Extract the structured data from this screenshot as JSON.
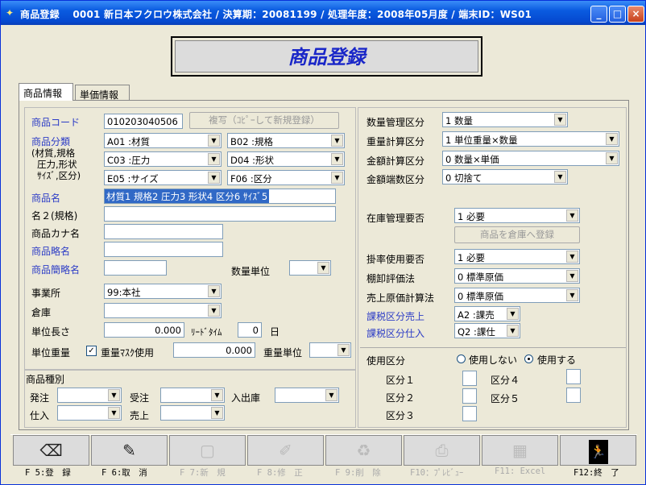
{
  "window": {
    "title": "商品登録　 0001 新日本フクロウ株式会社 / 決算期：20081199 / 処理年度：2008年05月度 / 端末ID：WS01",
    "min": "_",
    "max": "□",
    "close": "×"
  },
  "header": {
    "title": "商品登録"
  },
  "tabs": [
    {
      "label": "商品情報"
    },
    {
      "label": "単価情報"
    }
  ],
  "left": {
    "code_label": "商品コード",
    "code_value": "010203040506",
    "copy_button": "複写（ｺﾋﾟｰして新規登録）",
    "class_label": "商品分類",
    "class_sub1": "(材質,規格",
    "class_sub2": "圧力,形状",
    "class_sub3": "ｻｲｽﾞ,区分)",
    "class1": "A01 :材質",
    "class2": "B02 :規格",
    "class3": "C03 :圧力",
    "class4": "D04 :形状",
    "class5": "E05 :サイズ",
    "class6": "F06 :区分",
    "name_label": "商品名",
    "name_value": "材質1 規格2 圧力3 形状4 区分6 ｻｲｽﾞ5",
    "name2_label": "名２(規格)",
    "kana_label": "商品カナ名",
    "short_label": "商品略名",
    "shorter_label": "商品簡略名",
    "qty_unit_label": "数量単位",
    "office_label": "事業所",
    "office_value": "99:本社",
    "warehouse_label": "倉庫",
    "unit_len_label": "単位長さ",
    "unit_len_value": "0.000",
    "lead_label": "ﾘｰﾄﾞﾀｲﾑ",
    "lead_value": "0",
    "lead_unit": "日",
    "unit_wt_label": "単位重量",
    "mask_label": "重量ﾏｽｸ使用",
    "unit_wt_value": "0.000",
    "wt_unit_label": "重量単位"
  },
  "kinds": {
    "title": "商品種別",
    "order": "発注",
    "receive": "受注",
    "inout": "入出庫",
    "purchase": "仕入",
    "sales": "売上"
  },
  "right": {
    "qty_mgmt_label": "数量管理区分",
    "qty_mgmt_value": "1  数量",
    "wt_calc_label": "重量計算区分",
    "wt_calc_value": "1  単位重量×数量",
    "amt_calc_label": "金額計算区分",
    "amt_calc_value": "0  数量×単価",
    "frac_label": "金額端数区分",
    "frac_value": "0  切捨て",
    "stock_label": "在庫管理要否",
    "stock_value": "1  必要",
    "reg_wh_button": "商品を倉庫へ登録",
    "rate_label": "掛率使用要否",
    "rate_value": "1  必要",
    "inv_eval_label": "棚卸評価法",
    "inv_eval_value": "0  標準原価",
    "cost_label": "売上原価計算法",
    "cost_value": "0  標準原価",
    "tax_sales_label": "課税区分売上",
    "tax_sales_value": "A2 :課売",
    "tax_purch_label": "課税区分仕入",
    "tax_purch_value": "Q2 :課仕",
    "use_label": "使用区分",
    "use_no": "使用しない",
    "use_yes": "使用する",
    "div1": "区分１",
    "div2": "区分２",
    "div3": "区分３",
    "div4": "区分４",
    "div5": "区分５"
  },
  "fkeys": [
    {
      "label": "F 5:登　録"
    },
    {
      "label": "F 6:取　消"
    },
    {
      "label": "F 7:新　規"
    },
    {
      "label": "F 8:修　正"
    },
    {
      "label": "F 9:削　除"
    },
    {
      "label": "F10：ﾌﾟﾚﾋﾞｭｰ"
    },
    {
      "label": "F11: Excel"
    },
    {
      "label": "F12:終　了"
    }
  ]
}
